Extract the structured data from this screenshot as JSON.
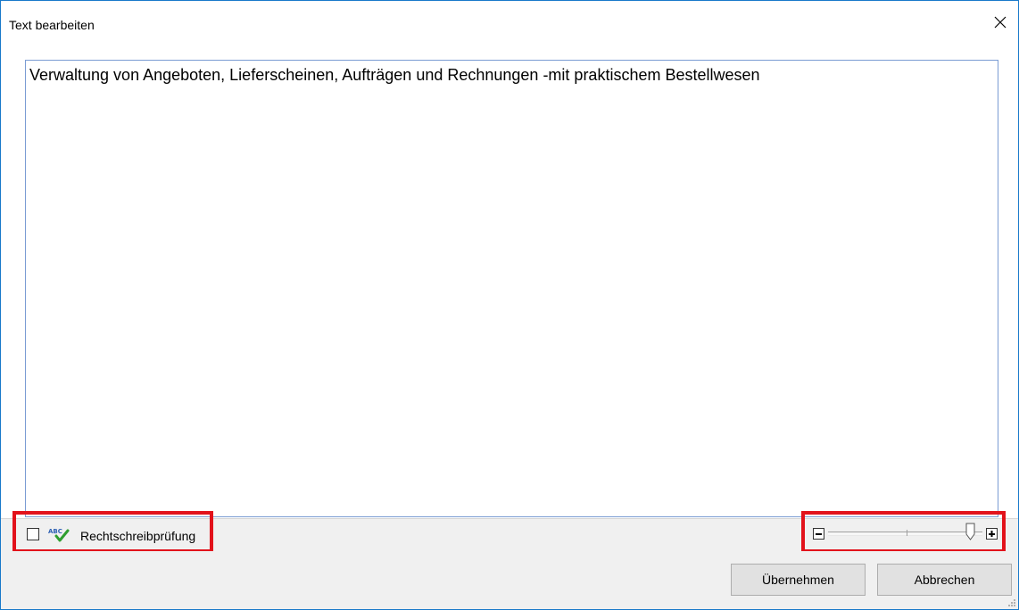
{
  "window": {
    "title": "Text bearbeiten",
    "close_icon": "close-icon"
  },
  "editor": {
    "text": "Verwaltung von Angeboten, Lieferscheinen, Aufträgen und Rechnungen -mit praktischem Bestellwesen"
  },
  "status": {
    "spellcheck_label": "Rechtschreibprüfung",
    "spellcheck_checked": false,
    "spellcheck_icon": "spellcheck-icon",
    "zoom_minus_icon": "minus-icon",
    "zoom_plus_icon": "plus-icon",
    "zoom_level_fraction": 0.92
  },
  "buttons": {
    "apply_label": "Übernehmen",
    "cancel_label": "Abbrechen"
  },
  "colors": {
    "highlight": "#e2121b",
    "window_border": "#1979ca"
  }
}
